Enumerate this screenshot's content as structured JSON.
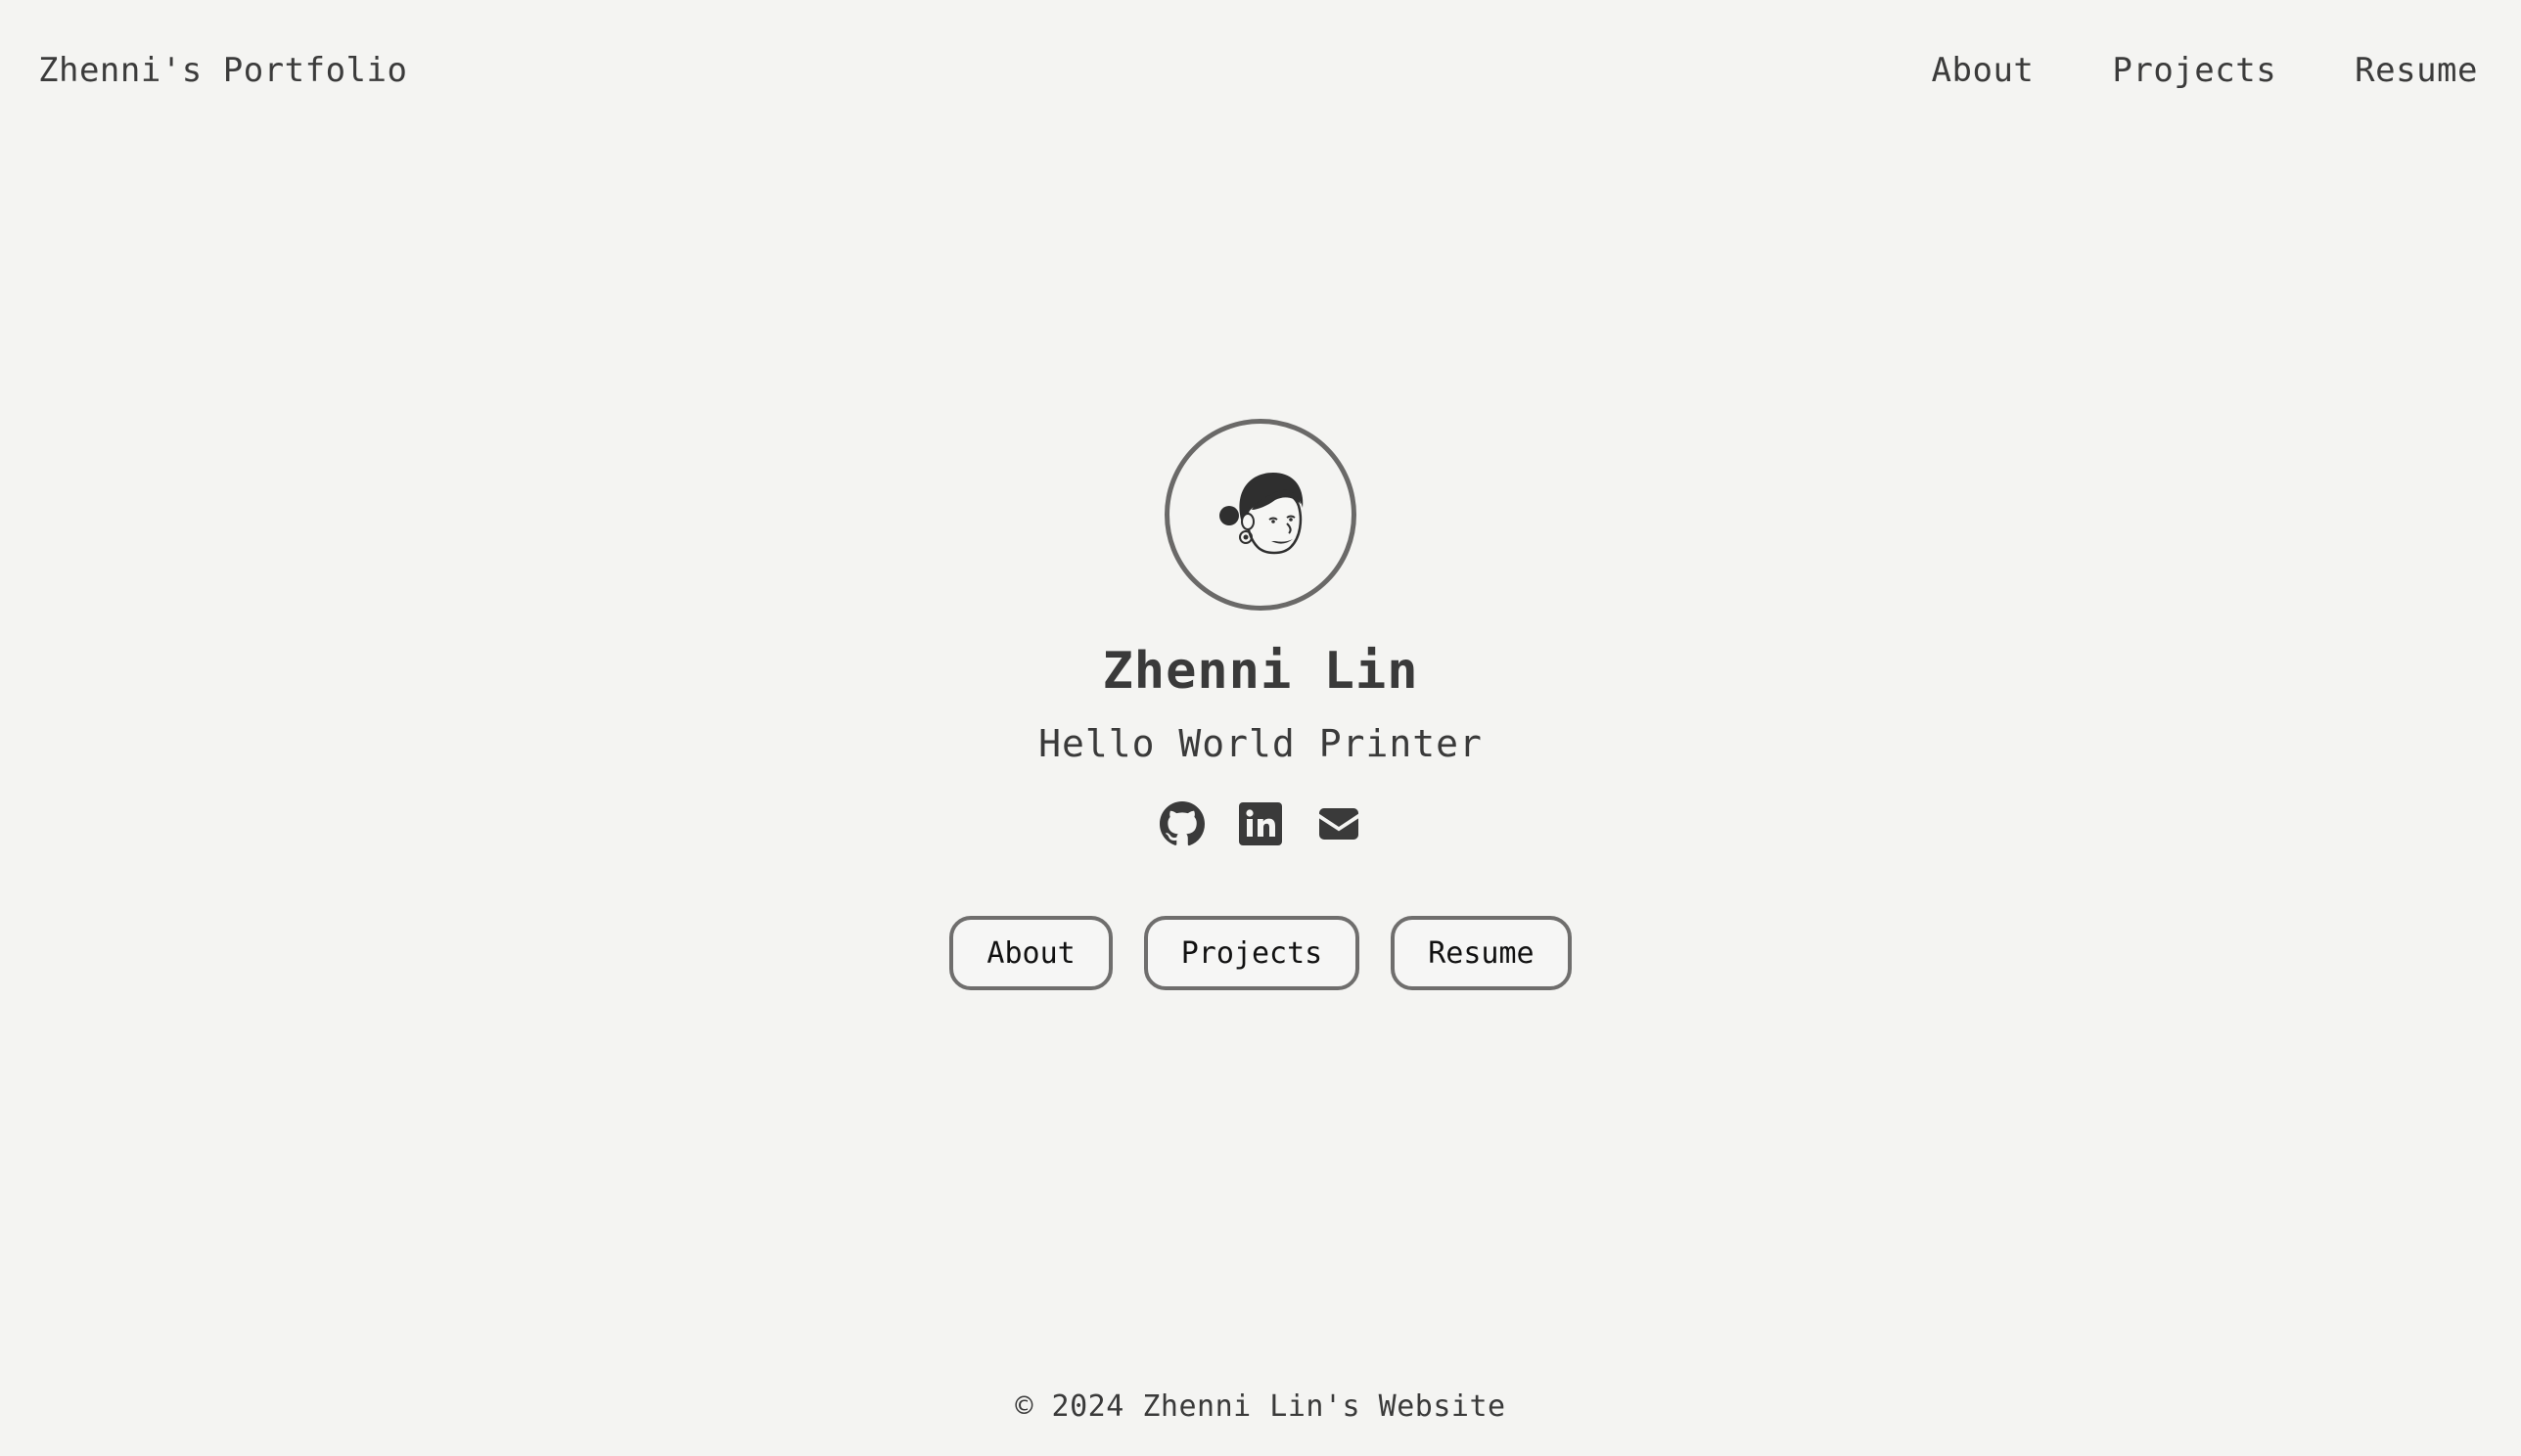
{
  "header": {
    "brand": "Zhenni's Portfolio",
    "nav": [
      "About",
      "Projects",
      "Resume"
    ]
  },
  "hero": {
    "avatar_icon": "avatar-illustration-icon",
    "name": "Zhenni Lin",
    "tagline": "Hello World Printer",
    "socials": [
      "github-icon",
      "linkedin-icon",
      "email-icon"
    ],
    "buttons": [
      "About",
      "Projects",
      "Resume"
    ]
  },
  "footer": {
    "text": "© 2024 Zhenni Lin's Website"
  },
  "colors": {
    "background": "#f4f4f2",
    "text": "#3a3a3a",
    "border": "#6f6e6d"
  }
}
